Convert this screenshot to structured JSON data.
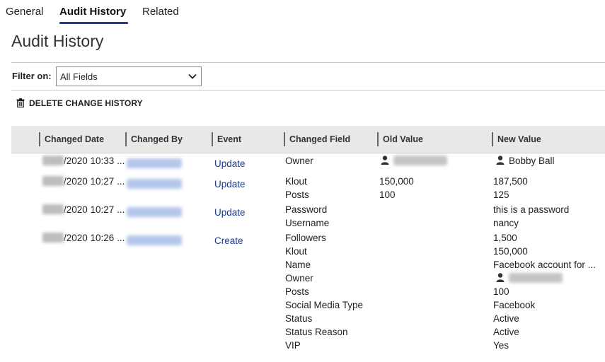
{
  "tabs": [
    {
      "label": "General"
    },
    {
      "label": "Audit History"
    },
    {
      "label": "Related"
    }
  ],
  "page_title": "Audit History",
  "filter": {
    "label": "Filter on:",
    "selected": "All Fields"
  },
  "toolbar": {
    "delete_label": "DELETE CHANGE HISTORY"
  },
  "columns": {
    "changed_date": "Changed Date",
    "changed_by": "Changed By",
    "event": "Event",
    "changed_field": "Changed Field",
    "old_value": "Old Value",
    "new_value": "New Value"
  },
  "rows": [
    {
      "date_suffix": "/2020 10:33 ...",
      "event": "Update",
      "fields": [
        "Owner"
      ],
      "old_values": [
        ""
      ],
      "new_values": [
        "Bobby Ball"
      ]
    },
    {
      "date_suffix": "/2020 10:27 ...",
      "event": "Update",
      "fields": [
        "Klout",
        "Posts"
      ],
      "old_values": [
        "150,000",
        "100"
      ],
      "new_values": [
        "187,500",
        "125"
      ]
    },
    {
      "date_suffix": "/2020 10:27 ...",
      "event": "Update",
      "fields": [
        "Password",
        "Username"
      ],
      "old_values": [
        "",
        ""
      ],
      "new_values": [
        "this is a password",
        "nancy"
      ]
    },
    {
      "date_suffix": "/2020 10:26 ...",
      "event": "Create",
      "fields": [
        "Followers",
        "Klout",
        "Name",
        "Owner",
        "Posts",
        "Social Media Type",
        "Status",
        "Status Reason",
        "VIP"
      ],
      "old_values": [
        "",
        "",
        "",
        "",
        "",
        "",
        "",
        "",
        ""
      ],
      "new_values": [
        "1,500",
        "150,000",
        "Facebook account for ...",
        "",
        "100",
        "Facebook",
        "Active",
        "Active",
        "Yes"
      ]
    }
  ],
  "colors": {
    "accent": "#243a8c",
    "link": "#1d3a8a",
    "header_bg": "#e8e8e8"
  },
  "icons": [
    "chevron-down-icon",
    "trash-icon",
    "person-icon"
  ]
}
